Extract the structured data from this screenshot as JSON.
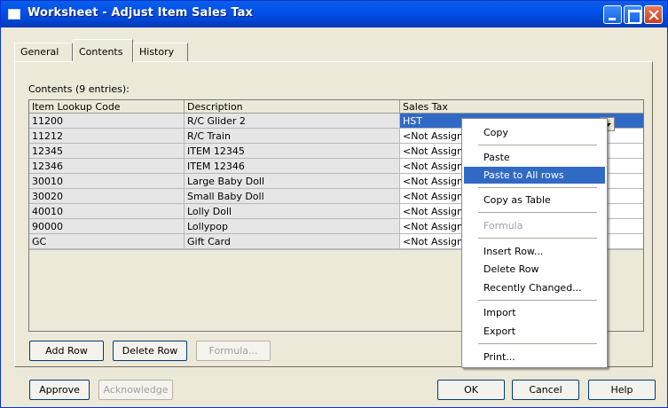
{
  "window": {
    "title": "Worksheet - Adjust Item Sales Tax"
  },
  "tabs": [
    {
      "label": "General",
      "accel": "G"
    },
    {
      "label": "Contents",
      "accel": ""
    },
    {
      "label": "History",
      "accel": "H"
    }
  ],
  "contents_label": "Contents (9 entries):",
  "grid": {
    "headers": [
      "Item Lookup Code",
      "Description",
      "Sales Tax"
    ],
    "rows": [
      {
        "code": "11200",
        "description": "R/C Glider 2",
        "tax": "HST"
      },
      {
        "code": "11212",
        "description": "R/C Train",
        "tax": "<Not Assigne"
      },
      {
        "code": "12345",
        "description": "ITEM 12345",
        "tax": "<Not Assigne"
      },
      {
        "code": "12346",
        "description": "ITEM 12346",
        "tax": "<Not Assigne"
      },
      {
        "code": "30010",
        "description": "Large Baby Doll",
        "tax": "<Not Assigne"
      },
      {
        "code": "30020",
        "description": "Small Baby Doll",
        "tax": "<Not Assigne"
      },
      {
        "code": "40010",
        "description": "Lolly Doll",
        "tax": "<Not Assigne"
      },
      {
        "code": "90000",
        "description": "Lollypop",
        "tax": "<Not Assigne"
      },
      {
        "code": "GC",
        "description": "Gift Card",
        "tax": "<Not Assigne"
      }
    ]
  },
  "grid_buttons": {
    "add_row": "Add Row",
    "delete_row": "Delete Row",
    "formula": "Formula..."
  },
  "context_menu": {
    "copy": "Copy",
    "paste": "Paste",
    "paste_all": "Paste to All rows",
    "copy_table": "Copy as Table",
    "formula": "Formula",
    "insert_row": "Insert Row...",
    "delete_row": "Delete Row",
    "recently_changed": "Recently Changed...",
    "import": "Import",
    "export": "Export",
    "print": "Print..."
  },
  "footer": {
    "approve": "Approve",
    "acknowledge": "Acknowledge",
    "ok": "OK",
    "cancel": "Cancel",
    "help": "Help"
  }
}
